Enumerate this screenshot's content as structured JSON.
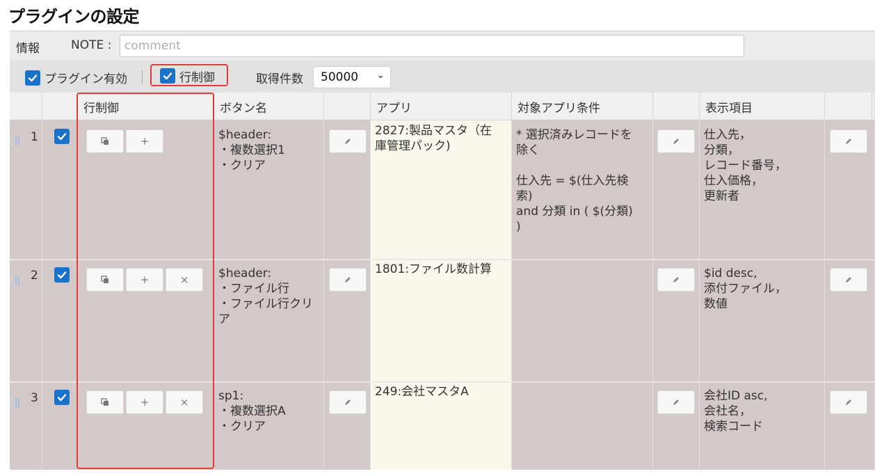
{
  "page": {
    "title": "プラグインの設定"
  },
  "info": {
    "label": "情報",
    "note_label": "NOTE :",
    "note_placeholder": "comment",
    "note_value": ""
  },
  "controls": {
    "plugin_enabled_label": "プラグイン有効",
    "plugin_enabled": true,
    "row_control_label": "行制御",
    "row_control": true,
    "fetch_count_label": "取得件数",
    "fetch_count_value": "50000"
  },
  "table": {
    "headers": {
      "row_control": "行制御",
      "button_name": "ボタン名",
      "app": "アプリ",
      "target_condition": "対象アプリ条件",
      "display_items": "表示項目"
    },
    "rows": [
      {
        "num": "1",
        "checked": true,
        "button_name": "$header:\n・複数選択1\n・クリア",
        "app": "2827:製品マスタ（在\n庫管理パック)",
        "condition": "* 選択済みレコードを\n除く\n\n仕入先 = $(仕入先検\n索)\nand 分類 in ( $(分類)\n)",
        "display": "仕入先，\n分類，\nレコード番号，\n仕入価格，\n更新者",
        "has_delete": false
      },
      {
        "num": "2",
        "checked": true,
        "button_name": "$header:\n・ファイル行\n・ファイル行クリ\nア",
        "app": "1801:ファイル数計算",
        "condition": "",
        "display": "$id desc,\n添付ファイル，\n数値",
        "has_delete": true
      },
      {
        "num": "3",
        "checked": true,
        "button_name": "sp1:\n・複数選択A\n・クリア",
        "app": "249:会社マスタA",
        "condition": "",
        "display": "会社ID asc,\n会社名，\n検索コード",
        "has_delete": true
      }
    ],
    "button_glyphs": {
      "copy": "copy-icon",
      "add": "+",
      "delete": "×",
      "edit": "pencil-icon"
    }
  },
  "colors": {
    "accent": "#1a73c8",
    "highlight": "#e03c3c",
    "row_bg": "#d3c9c9",
    "app_bg": "#faf8ec"
  }
}
